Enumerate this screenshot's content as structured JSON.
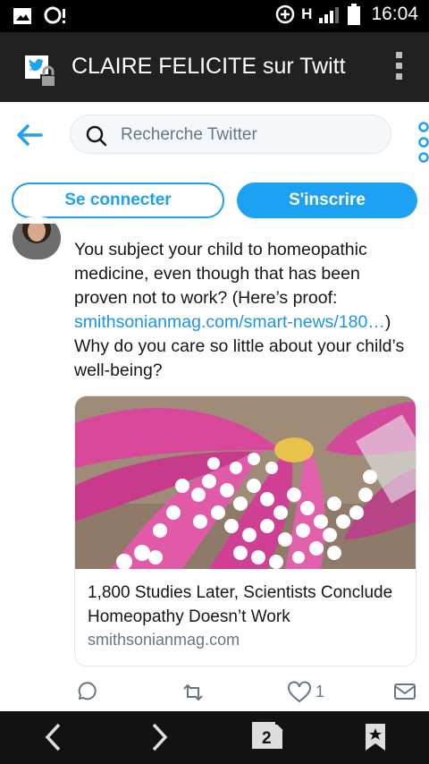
{
  "status_bar": {
    "time": "16:04",
    "network_label": "H",
    "icons": [
      "image-icon",
      "chat-bubble-icon",
      "data-saver-icon",
      "signal-icon",
      "battery-icon"
    ]
  },
  "title_bar": {
    "title": "CLAIRE FELICITE sur Twitt",
    "icon": "twitter-lock-icon",
    "menu_icon": "overflow-menu-icon"
  },
  "header": {
    "back_icon": "back-arrow-icon",
    "search_placeholder": "Recherche Twitter",
    "more_icon": "more-vertical-icon"
  },
  "auth": {
    "login_label": "Se connecter",
    "signup_label": "S'inscrire"
  },
  "tweet": {
    "text_before_link": "You subject your child to homeopathic medicine, even though that has been proven not to work? (Here’s proof: ",
    "link_text": "smithsonianmag.com/smart-news/180…",
    "text_after_link": ") Why do you care so little about your child’s well-being?",
    "card": {
      "title": "1,800 Studies Later, Scientists Conclude Homeopathy Doesn’t Work",
      "domain": "smithsonianmag.com",
      "image": "pink-flower-petals-with-white-pills-image"
    },
    "actions": {
      "like_count": "1"
    }
  },
  "nav_bar": {
    "tabs_count": "2"
  },
  "colors": {
    "twitter_blue": "#1da1f2",
    "link_blue": "#1b95e0",
    "title_bar_bg": "#212121",
    "nav_bar_bg": "#121212"
  }
}
